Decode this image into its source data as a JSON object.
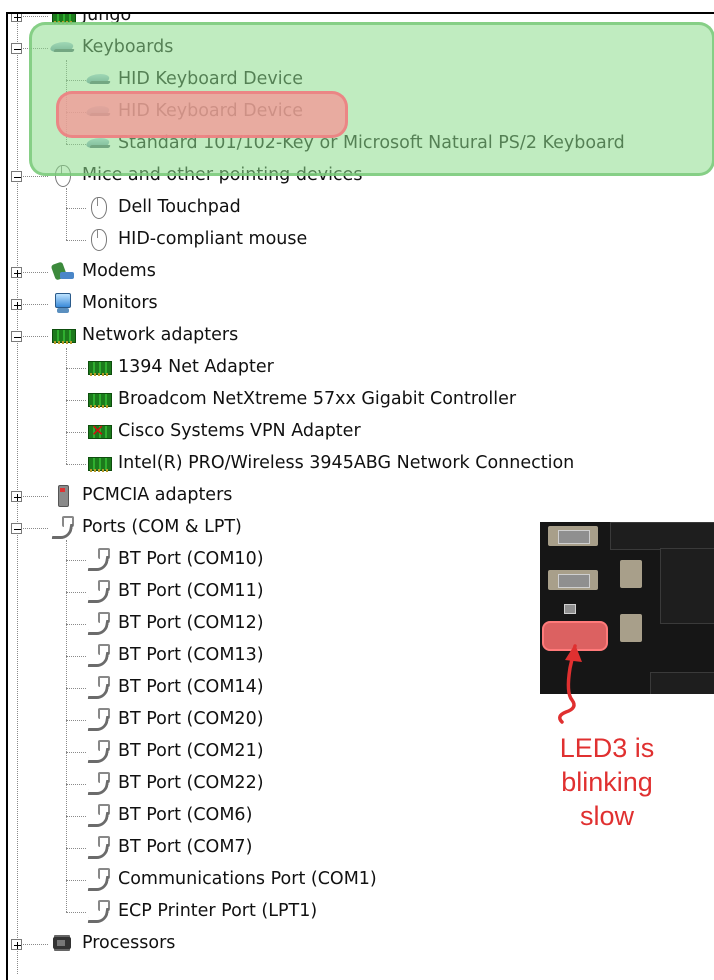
{
  "tree": {
    "items": [
      {
        "label": "Jungo",
        "icon": "network-card-icon",
        "level": 0,
        "expander": "plus"
      },
      {
        "label": "Keyboards",
        "icon": "keyboard-icon",
        "level": 0,
        "expander": "minus"
      },
      {
        "label": "HID Keyboard Device",
        "icon": "keyboard-icon",
        "level": 1
      },
      {
        "label": "HID Keyboard Device",
        "icon": "keyboard-icon",
        "level": 1
      },
      {
        "label": "Standard 101/102-Key or Microsoft Natural PS/2 Keyboard",
        "icon": "keyboard-icon",
        "level": 1
      },
      {
        "label": "Mice and other pointing devices",
        "icon": "mouse-icon",
        "level": 0,
        "expander": "minus"
      },
      {
        "label": "Dell Touchpad",
        "icon": "mouse-icon",
        "level": 1
      },
      {
        "label": "HID-compliant mouse",
        "icon": "mouse-icon",
        "level": 1
      },
      {
        "label": "Modems",
        "icon": "modem-icon",
        "level": 0,
        "expander": "plus"
      },
      {
        "label": "Monitors",
        "icon": "monitor-icon",
        "level": 0,
        "expander": "plus"
      },
      {
        "label": "Network adapters",
        "icon": "network-card-icon",
        "level": 0,
        "expander": "minus"
      },
      {
        "label": "1394 Net Adapter",
        "icon": "network-card-icon",
        "level": 1
      },
      {
        "label": "Broadcom NetXtreme 57xx Gigabit Controller",
        "icon": "network-card-icon",
        "level": 1
      },
      {
        "label": "Cisco Systems VPN Adapter",
        "icon": "network-card-disabled-icon",
        "level": 1
      },
      {
        "label": "Intel(R) PRO/Wireless 3945ABG Network Connection",
        "icon": "network-card-icon",
        "level": 1
      },
      {
        "label": "PCMCIA adapters",
        "icon": "pcmcia-icon",
        "level": 0,
        "expander": "plus"
      },
      {
        "label": "Ports (COM & LPT)",
        "icon": "port-icon",
        "level": 0,
        "expander": "minus"
      },
      {
        "label": "BT Port (COM10)",
        "icon": "port-icon",
        "level": 1
      },
      {
        "label": "BT Port (COM11)",
        "icon": "port-icon",
        "level": 1
      },
      {
        "label": "BT Port (COM12)",
        "icon": "port-icon",
        "level": 1
      },
      {
        "label": "BT Port (COM13)",
        "icon": "port-icon",
        "level": 1
      },
      {
        "label": "BT Port (COM14)",
        "icon": "port-icon",
        "level": 1
      },
      {
        "label": "BT Port (COM20)",
        "icon": "port-icon",
        "level": 1
      },
      {
        "label": "BT Port (COM21)",
        "icon": "port-icon",
        "level": 1
      },
      {
        "label": "BT Port (COM22)",
        "icon": "port-icon",
        "level": 1
      },
      {
        "label": "BT Port (COM6)",
        "icon": "port-icon",
        "level": 1
      },
      {
        "label": "BT Port (COM7)",
        "icon": "port-icon",
        "level": 1
      },
      {
        "label": "Communications Port (COM1)",
        "icon": "port-icon",
        "level": 1
      },
      {
        "label": "ECP Printer Port (LPT1)",
        "icon": "port-icon",
        "level": 1
      },
      {
        "label": "Processors",
        "icon": "processor-icon",
        "level": 0,
        "expander": "plus"
      }
    ]
  },
  "annotation": {
    "note_lines": [
      "LED3 is",
      "blinking",
      "slow"
    ],
    "note_color": "#e03030",
    "keyboard_group_highlight": "#8cdc8c",
    "selected_keyboard_highlight": "#f59696"
  }
}
